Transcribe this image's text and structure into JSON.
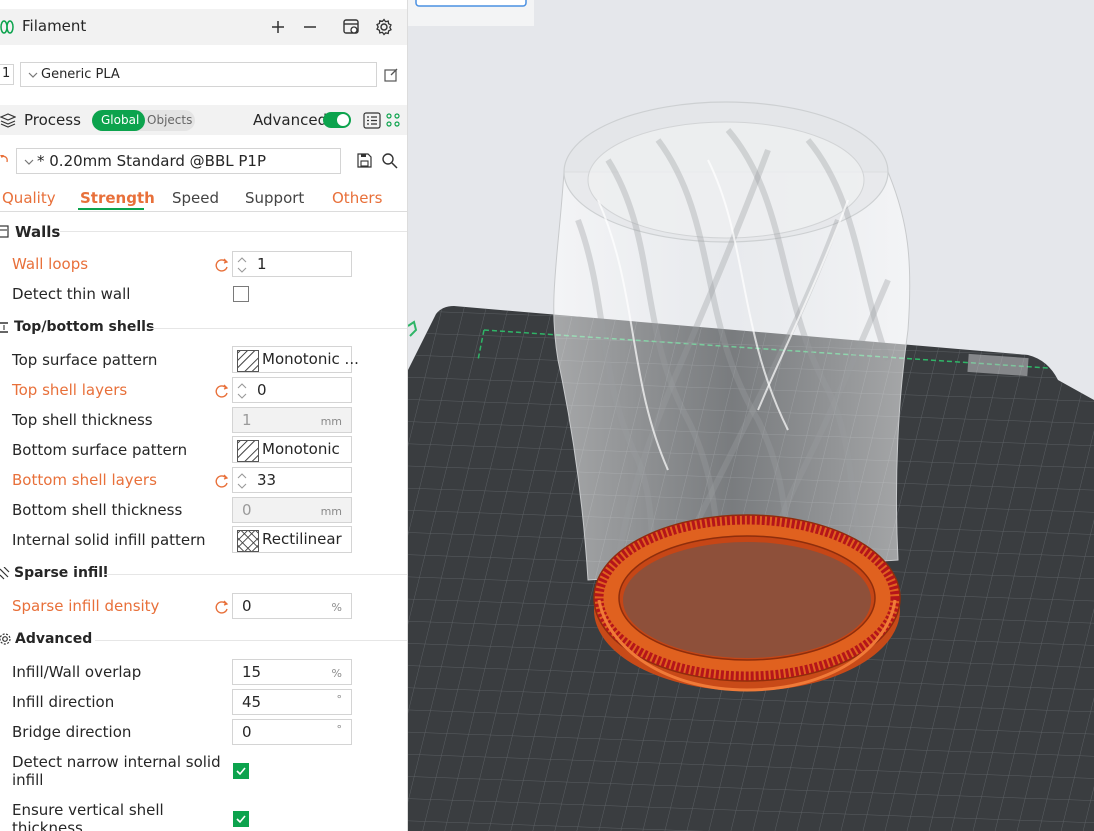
{
  "filament": {
    "title": "Filament",
    "slot_number": "1",
    "preset": "Generic PLA"
  },
  "process": {
    "title": "Process",
    "toggle_global": "Global",
    "toggle_objects": "Objects",
    "advanced_label": "Advanced",
    "advanced_on": true,
    "preset": "* 0.20mm Standard @BBL P1P"
  },
  "tabs": [
    {
      "label": "Quality",
      "state": "modified"
    },
    {
      "label": "Strength",
      "state": "active"
    },
    {
      "label": "Speed",
      "state": "normal"
    },
    {
      "label": "Support",
      "state": "normal"
    },
    {
      "label": "Others",
      "state": "modified"
    }
  ],
  "sections": {
    "walls": {
      "title": "Walls",
      "wall_loops": {
        "label": "Wall loops",
        "value": "1"
      },
      "detect_thin_wall": {
        "label": "Detect thin wall",
        "checked": false
      }
    },
    "top_bottom": {
      "title": "Top/bottom shells",
      "top_surface_pattern": {
        "label": "Top surface pattern",
        "value": "Monotonic ..."
      },
      "top_shell_layers": {
        "label": "Top shell layers",
        "value": "0"
      },
      "top_shell_thickness": {
        "label": "Top shell thickness",
        "value": "1",
        "unit": "mm"
      },
      "bottom_surface_pattern": {
        "label": "Bottom surface pattern",
        "value": "Monotonic"
      },
      "bottom_shell_layers": {
        "label": "Bottom shell layers",
        "value": "33"
      },
      "bottom_shell_thickness": {
        "label": "Bottom shell thickness",
        "value": "0",
        "unit": "mm"
      },
      "internal_solid_infill_pattern": {
        "label": "Internal solid infill pattern",
        "value": "Rectilinear"
      }
    },
    "sparse_infill": {
      "title": "Sparse infill",
      "density": {
        "label": "Sparse infill density",
        "value": "0",
        "unit": "%"
      }
    },
    "advanced": {
      "title": "Advanced",
      "infill_wall_overlap": {
        "label": "Infill/Wall overlap",
        "value": "15",
        "unit": "%"
      },
      "infill_direction": {
        "label": "Infill direction",
        "value": "45",
        "unit": "°"
      },
      "bridge_direction": {
        "label": "Bridge direction",
        "value": "0",
        "unit": "°"
      },
      "detect_narrow": {
        "label_line1": "Detect narrow internal solid",
        "label_line2": "infill",
        "checked": true
      },
      "ensure_vertical": {
        "label_line1": "Ensure vertical shell",
        "label_line2": "thickness",
        "checked": true
      }
    }
  },
  "colors": {
    "accent_green": "#0ca34d",
    "modified_orange": "#e8703a",
    "plate_dark": "#3a3d40",
    "model_orange": "#d9541e"
  },
  "icons": [
    "filament-spool-icon",
    "plus-icon",
    "minus-icon",
    "filament-config-icon",
    "settings-gear-icon",
    "edit-icon",
    "process-layers-icon",
    "list-view-icon",
    "object-tree-icon",
    "reset-arrow-icon",
    "save-icon",
    "search-icon"
  ]
}
